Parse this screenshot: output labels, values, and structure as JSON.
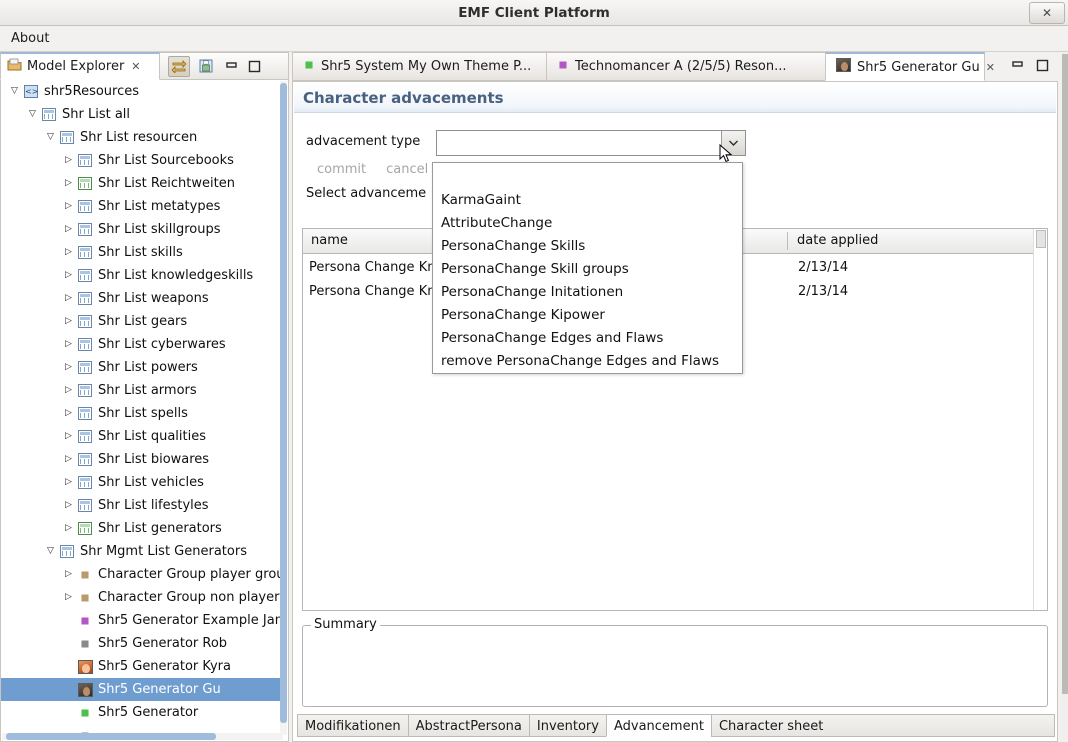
{
  "window": {
    "title": "EMF Client Platform",
    "close_label": "✕",
    "close_icon": "close-icon"
  },
  "menubar": {
    "items": [
      {
        "label": "About"
      }
    ]
  },
  "left_view": {
    "tab": {
      "label": "Model Explorer",
      "close_glyph": "✕",
      "icon": "model-explorer-icon"
    },
    "toolbar": {
      "link_with_editor_label": "⇆",
      "collapse_all_label": "▤",
      "minimize_label": "▬",
      "maximize_label": "❐"
    },
    "tree": [
      {
        "indent": 0,
        "twisty": "▽",
        "icon": "resource-icon",
        "label": "shr5Resources",
        "selected": false
      },
      {
        "indent": 1,
        "twisty": "▽",
        "icon": "table-icon",
        "label": "Shr List all",
        "selected": false
      },
      {
        "indent": 2,
        "twisty": "▽",
        "icon": "table-icon",
        "label": "Shr List resourcen",
        "selected": false
      },
      {
        "indent": 3,
        "twisty": "▷",
        "icon": "table-icon",
        "label": "Shr List Sourcebooks",
        "selected": false
      },
      {
        "indent": 3,
        "twisty": "▷",
        "icon": "table-icon-green",
        "label": "Shr List Reichtweiten",
        "selected": false
      },
      {
        "indent": 3,
        "twisty": "▷",
        "icon": "table-icon",
        "label": "Shr List metatypes",
        "selected": false
      },
      {
        "indent": 3,
        "twisty": "▷",
        "icon": "table-icon",
        "label": "Shr List skillgroups",
        "selected": false
      },
      {
        "indent": 3,
        "twisty": "▷",
        "icon": "table-icon",
        "label": "Shr List skills",
        "selected": false
      },
      {
        "indent": 3,
        "twisty": "▷",
        "icon": "table-icon",
        "label": "Shr List knowledgeskills",
        "selected": false
      },
      {
        "indent": 3,
        "twisty": "▷",
        "icon": "table-icon",
        "label": "Shr List weapons",
        "selected": false
      },
      {
        "indent": 3,
        "twisty": "▷",
        "icon": "table-icon",
        "label": "Shr List gears",
        "selected": false
      },
      {
        "indent": 3,
        "twisty": "▷",
        "icon": "table-icon",
        "label": "Shr List cyberwares",
        "selected": false
      },
      {
        "indent": 3,
        "twisty": "▷",
        "icon": "table-icon",
        "label": "Shr List powers",
        "selected": false
      },
      {
        "indent": 3,
        "twisty": "▷",
        "icon": "table-icon",
        "label": "Shr List armors",
        "selected": false
      },
      {
        "indent": 3,
        "twisty": "▷",
        "icon": "table-icon",
        "label": "Shr List spells",
        "selected": false
      },
      {
        "indent": 3,
        "twisty": "▷",
        "icon": "table-icon",
        "label": "Shr List qualities",
        "selected": false
      },
      {
        "indent": 3,
        "twisty": "▷",
        "icon": "table-icon",
        "label": "Shr List biowares",
        "selected": false
      },
      {
        "indent": 3,
        "twisty": "▷",
        "icon": "table-icon",
        "label": "Shr List vehicles",
        "selected": false
      },
      {
        "indent": 3,
        "twisty": "▷",
        "icon": "table-icon",
        "label": "Shr List lifestyles",
        "selected": false
      },
      {
        "indent": 3,
        "twisty": "▷",
        "icon": "table-icon-green",
        "label": "Shr List generators",
        "selected": false
      },
      {
        "indent": 2,
        "twisty": "▽",
        "icon": "table-icon",
        "label": "Shr Mgmt List Generators",
        "selected": false
      },
      {
        "indent": 3,
        "twisty": "▷",
        "icon": "diamond-tan",
        "label": "Character Group player grou",
        "selected": false
      },
      {
        "indent": 3,
        "twisty": "▷",
        "icon": "diamond-tan",
        "label": "Character Group non player",
        "selected": false
      },
      {
        "indent": 3,
        "twisty": "",
        "icon": "diamond-purple",
        "label": "Shr5 Generator Example Jan",
        "selected": false
      },
      {
        "indent": 3,
        "twisty": "",
        "icon": "diamond-grey",
        "label": "Shr5 Generator Rob",
        "selected": false
      },
      {
        "indent": 3,
        "twisty": "",
        "icon": "photo-kyra",
        "label": "Shr5 Generator Kyra",
        "selected": false
      },
      {
        "indent": 3,
        "twisty": "",
        "icon": "photo-gu",
        "label": "Shr5 Generator Gu",
        "selected": true
      },
      {
        "indent": 3,
        "twisty": "",
        "icon": "diamond-green",
        "label": "Shr5 Generator",
        "selected": false
      }
    ]
  },
  "editor": {
    "tabs": [
      {
        "label": "Shr5 System My Own Theme P...",
        "icon": "diamond-green-icon",
        "active": false,
        "closable": false
      },
      {
        "label": "Technomancer A (2/5/5) Reson...",
        "icon": "diamond-purple-icon",
        "active": false,
        "closable": false
      },
      {
        "label": "Shr5 Generator Gu",
        "icon": "photo-gu-icon",
        "active": true,
        "closable": true,
        "close_glyph": "✕"
      }
    ],
    "window_buttons": {
      "minimize": "▬",
      "maximize": "❐"
    },
    "form": {
      "title": "Character advacements",
      "advancement_type_label": "advacement type",
      "advancement_type_value": "",
      "commit_label": "commit",
      "cancel_label": "cancel",
      "select_label": "Select advanceme",
      "table": {
        "columns": [
          "name",
          "date applied"
        ],
        "rows": [
          {
            "name": "Persona Change Kn",
            "date": "2/13/14"
          },
          {
            "name": "Persona Change Kn",
            "date": "2/13/14"
          }
        ]
      },
      "summary_group_title": "Summary",
      "summary_text": ""
    },
    "bottom_tabs": [
      {
        "label": "Modifikationen",
        "active": false
      },
      {
        "label": "AbstractPersona",
        "active": false
      },
      {
        "label": "Inventory",
        "active": false
      },
      {
        "label": "Advancement",
        "active": true
      },
      {
        "label": "Character sheet",
        "active": false
      }
    ]
  },
  "dropdown": {
    "open": true,
    "items": [
      "KarmaGaint",
      "AttributeChange",
      "PersonaChange Skills",
      "PersonaChange Skill groups",
      "PersonaChange Initationen",
      "PersonaChange Kipower",
      "PersonaChange Edges and Flaws",
      "remove PersonaChange Edges and Flaws"
    ]
  },
  "colors": {
    "selection": "#6f9dd0",
    "form_title": "#47617f",
    "disabled_text": "#a6a6a6",
    "window_bg": "#f2f1f0"
  }
}
